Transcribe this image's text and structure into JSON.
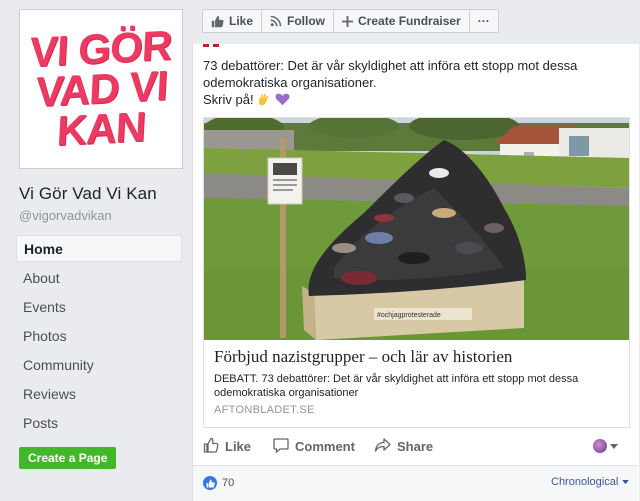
{
  "sidebar": {
    "logo_lines": [
      "VI GÖR",
      "VAD VI",
      "KAN"
    ],
    "page_name": "Vi Gör Vad Vi Kan",
    "handle": "@vigorvadvikan",
    "nav": [
      {
        "label": "Home",
        "active": true
      },
      {
        "label": "About"
      },
      {
        "label": "Events"
      },
      {
        "label": "Photos"
      },
      {
        "label": "Community"
      },
      {
        "label": "Reviews"
      },
      {
        "label": "Posts"
      }
    ],
    "create_page_label": "Create a Page"
  },
  "action_bar": {
    "like_label": "Like",
    "follow_label": "Follow",
    "fundraiser_label": "Create Fundraiser",
    "more_label": "···"
  },
  "post": {
    "text_line1": "73 debattörer: Det är vår skyldighet att införa ett stopp mot dessa",
    "text_line2": "odemokratiska organisationer.",
    "text_line3": "Skriv på!",
    "sign_text": "#ochjagprotesterade",
    "link": {
      "title": "Förbjud nazistgrupper – och lär av historien",
      "description": "DEBATT. 73 debattörer: Det är vår skyldighet att införa ett stopp mot dessa odemokratiska organisationer",
      "domain": "AFTONBLADET.SE"
    },
    "actions": {
      "like": "Like",
      "comment": "Comment",
      "share": "Share"
    },
    "reactions": {
      "count": "70",
      "sort_label": "Chronological"
    }
  },
  "colors": {
    "brand_pink": "#ec3a62",
    "fb_blue": "#3578e5",
    "link_blue": "#385898",
    "green": "#42b72a"
  }
}
